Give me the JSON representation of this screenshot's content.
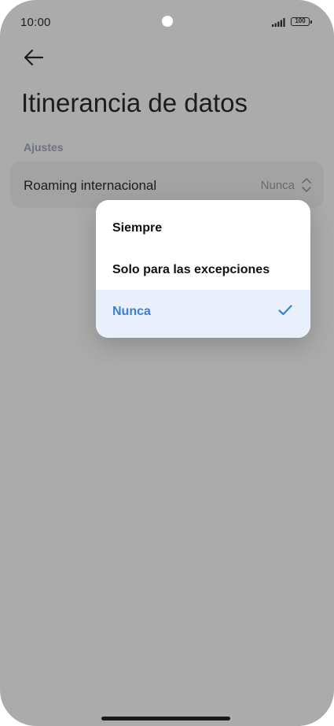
{
  "status_bar": {
    "time": "10:00",
    "battery": "100"
  },
  "header": {
    "back_icon": "arrow-left-icon",
    "title": "Itinerancia de datos"
  },
  "section": {
    "label": "Ajustes"
  },
  "setting": {
    "label": "Roaming internacional",
    "value": "Nunca",
    "icon": "chevron-up-down-icon"
  },
  "dropdown": {
    "options": [
      {
        "label": "Siempre",
        "selected": false
      },
      {
        "label": "Solo para las excepciones",
        "selected": false
      },
      {
        "label": "Nunca",
        "selected": true
      }
    ],
    "check_icon": "check-icon"
  },
  "colors": {
    "scrim_background": "#ababab",
    "accent": "#3b7fd9",
    "selected_row": "#e9f0fc",
    "card": "#a3a3a3"
  }
}
